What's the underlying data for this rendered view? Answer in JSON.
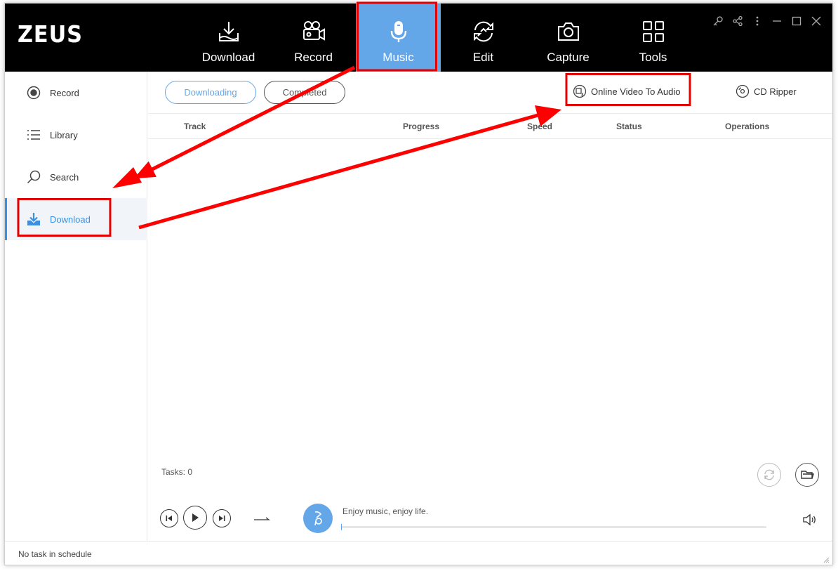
{
  "app": {
    "logo": "ZEUS"
  },
  "nav": [
    {
      "label": "Download",
      "icon": "download-tray-icon"
    },
    {
      "label": "Record",
      "icon": "camcorder-icon"
    },
    {
      "label": "Music",
      "icon": "microphone-icon",
      "active": true
    },
    {
      "label": "Edit",
      "icon": "edit-refresh-icon"
    },
    {
      "label": "Capture",
      "icon": "camera-icon"
    },
    {
      "label": "Tools",
      "icon": "tools-grid-icon"
    }
  ],
  "window_controls": [
    "key-icon",
    "share-icon",
    "more-icon",
    "minimize-icon",
    "maximize-icon",
    "close-icon"
  ],
  "sidebar": {
    "items": [
      {
        "label": "Record",
        "icon": "record-icon"
      },
      {
        "label": "Library",
        "icon": "list-icon"
      },
      {
        "label": "Search",
        "icon": "search-icon"
      },
      {
        "label": "Download",
        "icon": "download-icon",
        "active": true
      }
    ]
  },
  "tabs": {
    "downloading": "Downloading",
    "completed": "Completed"
  },
  "tools": {
    "online_video_to_audio": "Online Video To Audio",
    "cd_ripper": "CD Ripper"
  },
  "table": {
    "columns": [
      "Track",
      "Progress",
      "Speed",
      "Status",
      "Operations"
    ]
  },
  "footer": {
    "tasks": "Tasks: 0"
  },
  "player": {
    "tagline": "Enjoy music, enjoy life.",
    "progress": 0
  },
  "statusbar": {
    "text": "No task in schedule"
  },
  "colors": {
    "accent": "#63a7e9",
    "annotation": "#ff0000",
    "topbar": "#000000"
  }
}
